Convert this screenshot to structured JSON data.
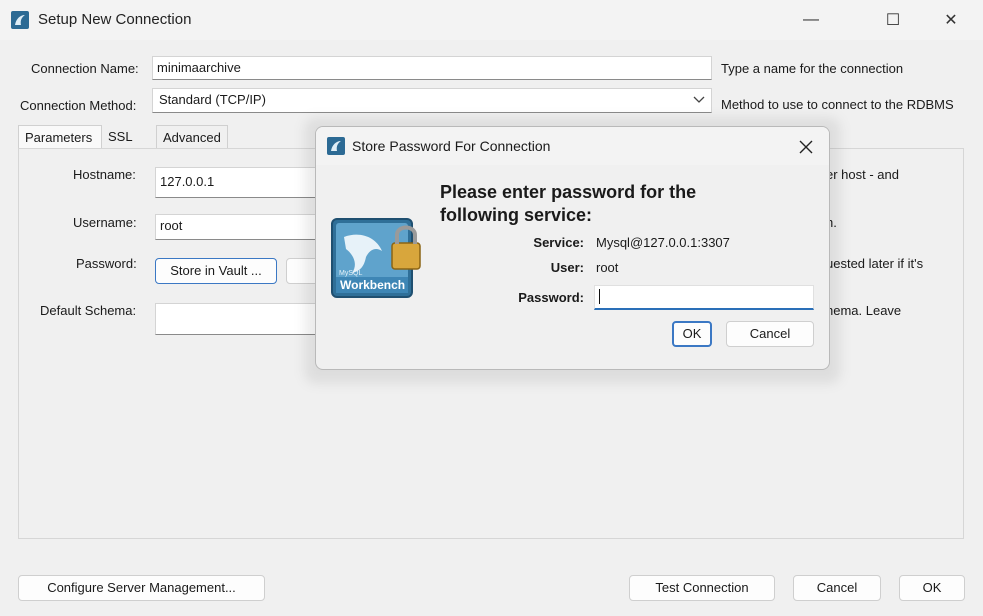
{
  "window": {
    "title": "Setup New Connection",
    "minimize_glyph": "—",
    "maximize_glyph": "☐",
    "close_glyph": "✕"
  },
  "form": {
    "connection_name_label": "Connection Name:",
    "connection_name_value": "minimaarchive",
    "connection_name_hint": "Type a name for the connection",
    "connection_method_label": "Connection Method:",
    "connection_method_value": "Standard (TCP/IP)",
    "connection_method_hint": "Method to use to connect to the RDBMS"
  },
  "tabs": [
    {
      "label": "Parameters"
    },
    {
      "label": "SSL"
    },
    {
      "label": "Advanced"
    }
  ],
  "parameters": {
    "hostname_label": "Hostname:",
    "hostname_value": "127.0.0.1",
    "username_label": "Username:",
    "username_value": "root",
    "password_label": "Password:",
    "store_in_vault_label": "Store in Vault ...",
    "default_schema_label": "Default Schema:",
    "hint_host": "er host - and",
    "hint_user": "h.",
    "hint_password": "uested later if it's",
    "hint_schema": "hema. Leave"
  },
  "footer": {
    "configure_label": "Configure Server Management...",
    "test_connection_label": "Test Connection",
    "cancel_label": "Cancel",
    "ok_label": "OK"
  },
  "dialog": {
    "title": "Store Password For Connection",
    "heading": "Please enter password for the following service:",
    "service_label": "Service:",
    "service_value": "Mysql@127.0.0.1:3307",
    "user_label": "User:",
    "user_value": "root",
    "password_label": "Password:",
    "password_value": "",
    "ok_label": "OK",
    "cancel_label": "Cancel",
    "logo_text_top": "MySQL",
    "logo_text": "Workbench"
  },
  "colors": {
    "accent": "#2a6fb8",
    "app_icon": "#2c6a94",
    "window_bg": "#f0f0f0"
  }
}
